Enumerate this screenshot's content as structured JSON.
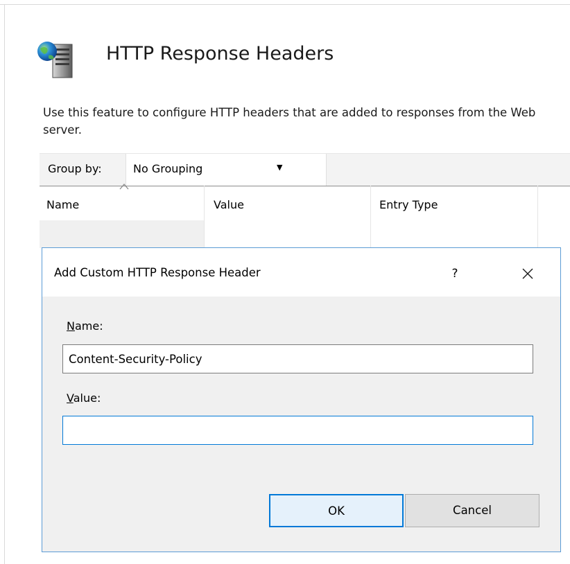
{
  "page": {
    "title": "HTTP Response Headers",
    "description": "Use this feature to configure HTTP headers that are added to responses from the Web server.",
    "icon": "server-globe-icon"
  },
  "toolbar": {
    "group_by_label": "Group by:",
    "group_by_value": "No Grouping"
  },
  "list": {
    "columns": [
      "Name",
      "Value",
      "Entry Type"
    ],
    "sort_column": "Name"
  },
  "dialog": {
    "title": "Add Custom HTTP Response Header",
    "help_label": "?",
    "name_label_accel": "N",
    "name_label_rest": "ame:",
    "name_value": "Content-Security-Policy",
    "value_label_accel": "V",
    "value_label_rest": "alue:",
    "value_value": "",
    "ok_label": "OK",
    "cancel_label": "Cancel"
  },
  "colors": {
    "accent": "#0078d7",
    "dialog_border": "#5b9bd5",
    "dialog_bg": "#f0f0f0"
  }
}
